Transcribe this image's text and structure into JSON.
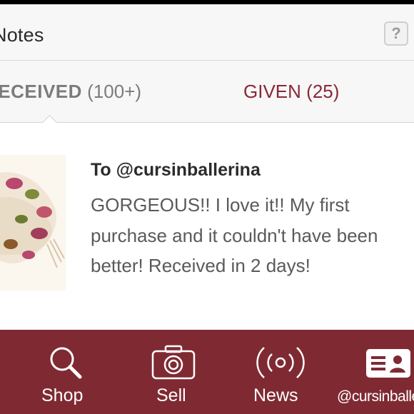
{
  "header": {
    "title": "Notes",
    "help_label": "?"
  },
  "tabs": [
    {
      "label": "RECEIVED",
      "count": "(100+)"
    },
    {
      "label": "GIVEN",
      "count": "(25)"
    }
  ],
  "note": {
    "to": "To @cursinballerina",
    "text": "GORGEOUS!! I love it!! My first purchase and it couldn't have been better! Received in 2 days!"
  },
  "bottom_nav": [
    {
      "label": "Shop",
      "icon": "search-icon"
    },
    {
      "label": "Sell",
      "icon": "camera-icon"
    },
    {
      "label": "News",
      "icon": "broadcast-icon"
    },
    {
      "label": "@cursinballerina",
      "icon": "profile-card-icon"
    }
  ],
  "colors": {
    "accent": "#8a2838",
    "nav_background": "#7f2a33"
  }
}
